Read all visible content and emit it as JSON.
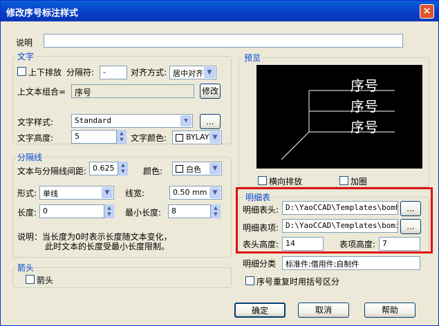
{
  "window": {
    "title": "修改序号标注样式",
    "close_glyph": "×"
  },
  "desc": {
    "label": "说明",
    "value": ""
  },
  "text_group": {
    "title": "文字",
    "vertical_label": "上下排放",
    "separator_label": "分隔符:",
    "separator_value": "-",
    "align_label": "对齐方式:",
    "align_value": "居中对齐",
    "upper_combo_label": "上文本组合=",
    "upper_combo_value": "序号",
    "modify_button": "修改",
    "style_label": "文字样式:",
    "style_value": "Standard",
    "style_button": "...",
    "height_label": "文字高度:",
    "height_value": "5",
    "color_label": "文字颜色:",
    "color_value": "BYLAYER"
  },
  "divider_group": {
    "title": "分隔线",
    "gap_label": "文本与分隔线间距:",
    "gap_value": "0.625",
    "color_label": "颜色:",
    "color_value": "白色",
    "form_label": "形式:",
    "form_value": "单线",
    "width_label": "线宽:",
    "width_value": "0.50 mm",
    "length_label": "长度:",
    "length_value": "0",
    "minlen_label": "最小长度:",
    "minlen_value": "8",
    "note_line1": "说明：当长度为0时表示长度随文本变化，",
    "note_line2": "此时文本的长度受最小长度限制。"
  },
  "arrow_group": {
    "title": "箭头",
    "arrow_label": "箭头"
  },
  "preview": {
    "title": "预览",
    "sample_text": "序号",
    "horizontal_label": "横向排放",
    "circle_label": "加圈"
  },
  "bom": {
    "title": "明细表",
    "header_label": "明细表头:",
    "header_value": "D:\\YaoCCAD\\Templates\\bomhea",
    "item_label": "明细表项:",
    "item_value": "D:\\YaoCCAD\\Templates\\bomite",
    "browse": "...",
    "header_height_label": "表头高度:",
    "header_height_value": "14",
    "item_height_label": "表项高度:",
    "item_height_value": "7"
  },
  "category": {
    "label": "明细分类",
    "value": "标准件;借用件;自制件"
  },
  "bracket_label": "序号重复时用括号区分",
  "buttons": {
    "ok": "确定",
    "cancel": "取消",
    "help": "帮助"
  }
}
